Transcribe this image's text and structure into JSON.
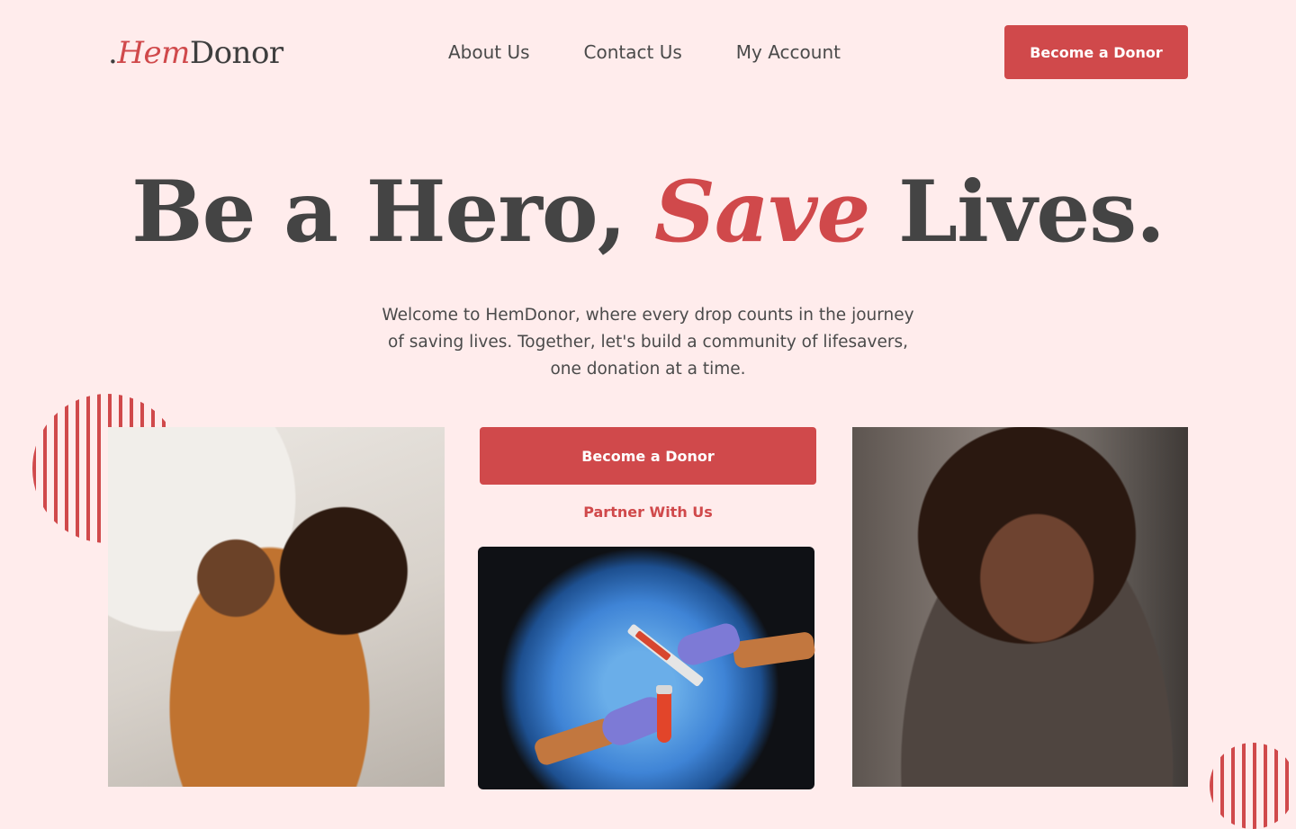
{
  "header": {
    "logo": {
      "dot": ".",
      "hem": "Hem",
      "donor": "Donor"
    },
    "nav": [
      {
        "label": "About Us"
      },
      {
        "label": "Contact Us"
      },
      {
        "label": "My Account"
      }
    ],
    "cta_label": "Become a Donor"
  },
  "hero": {
    "title_part1": "Be a Hero, ",
    "title_accent": "Save",
    "title_part2": " Lives.",
    "subtitle": "Welcome to HemDonor, where every drop counts in the journey of saving lives. Together, let's build a community of lifesavers, one donation at a time.",
    "primary_cta": "Become a Donor",
    "secondary_cta": "Partner With Us"
  },
  "colors": {
    "background": "#ffecec",
    "accent": "#d0494b",
    "text": "#444444"
  },
  "icons": [
    "stripe-circle-decoration"
  ]
}
